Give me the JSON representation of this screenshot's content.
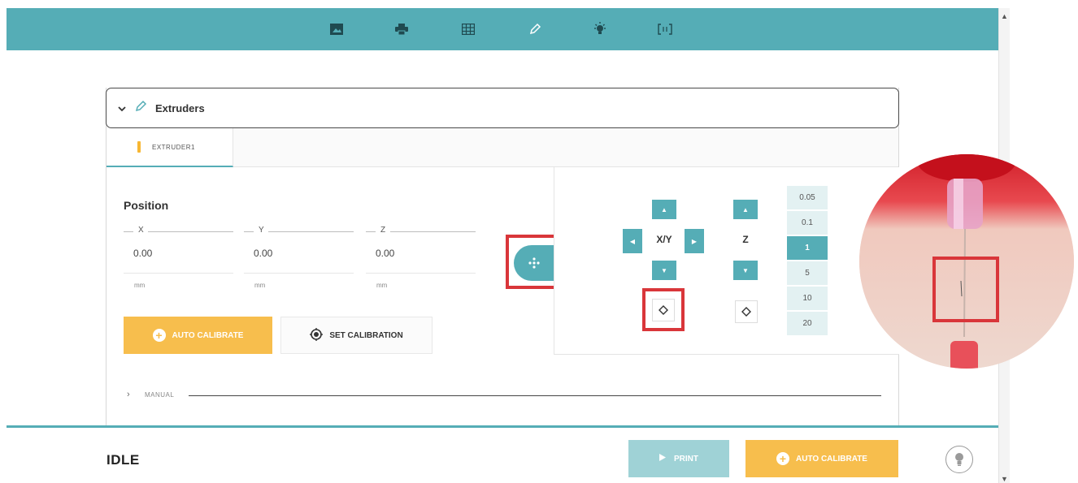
{
  "toolbar": {
    "icons": [
      "image-icon",
      "printer-icon",
      "grid-icon",
      "pen-icon",
      "bulb-icon",
      "bracket-icon"
    ]
  },
  "panel": {
    "title": "Extruders",
    "tab_label": "EXTRUDER1"
  },
  "position": {
    "title": "Position",
    "fields": [
      {
        "label": "X",
        "value": "0.00",
        "unit": "mm"
      },
      {
        "label": "Y",
        "value": "0.00",
        "unit": "mm"
      },
      {
        "label": "Z",
        "value": "0.00",
        "unit": "mm"
      }
    ]
  },
  "buttons": {
    "auto_calibrate": "AUTO CALIBRATE",
    "set_calibration": "SET CALIBRATION"
  },
  "manual": {
    "label": "MANUAL"
  },
  "jog": {
    "xy_label": "X/Y",
    "z_label": "Z",
    "steps": [
      "0.05",
      "0.1",
      "1",
      "5",
      "10",
      "20"
    ],
    "selected_step": "1"
  },
  "status": {
    "text": "IDLE",
    "print_label": "PRINT",
    "auto_calibrate_label": "AUTO CALIBRATE"
  },
  "colors": {
    "accent": "#55adb6",
    "warning": "#f7be4d",
    "highlight": "#d9363a"
  }
}
